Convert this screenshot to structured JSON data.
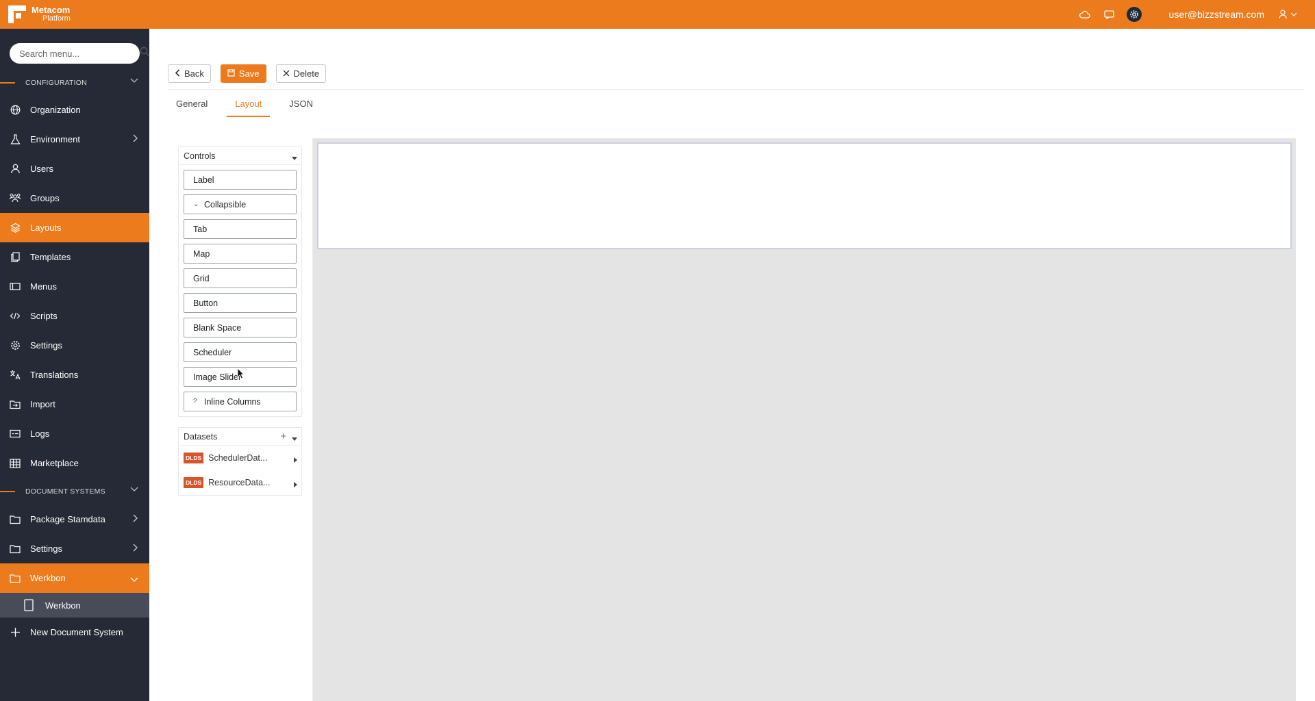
{
  "brand": {
    "name": "Metacom",
    "sub": "Platform",
    "color": "#ec7b1e"
  },
  "topbar": {
    "icons": [
      "cloud-icon",
      "chat-icon",
      "gear-icon",
      "user-icon"
    ],
    "user_email": "user@bizzstream.com"
  },
  "sidebar": {
    "search_placeholder": "Search menu...",
    "section_config": "CONFIGURATION",
    "config_items": [
      {
        "label": "Organization",
        "icon": "globe-icon"
      },
      {
        "label": "Environment",
        "icon": "flask-icon"
      },
      {
        "label": "Users",
        "icon": "user-icon"
      },
      {
        "label": "Groups",
        "icon": "group-icon"
      },
      {
        "label": "Layouts",
        "icon": "layers-icon"
      },
      {
        "label": "Templates",
        "icon": "copy-icon"
      },
      {
        "label": "Menus",
        "icon": "menu-icon"
      },
      {
        "label": "Scripts",
        "icon": "code-icon"
      },
      {
        "label": "Settings",
        "icon": "gear-icon"
      },
      {
        "label": "Translations",
        "icon": "translate-icon"
      },
      {
        "label": "Import",
        "icon": "import-icon"
      },
      {
        "label": "Logs",
        "icon": "logs-icon"
      },
      {
        "label": "Marketplace",
        "icon": "grid-icon"
      }
    ],
    "section_docs": "DOCUMENT SYSTEMS",
    "doc_items": [
      {
        "label": "Package Stamdata"
      },
      {
        "label": "Settings"
      },
      {
        "label": "Werkbon"
      }
    ],
    "sub_item": "Werkbon",
    "new_item": "New Document System"
  },
  "toolbar": {
    "back": "Back",
    "save": "Save",
    "delete": "Delete"
  },
  "tabs": [
    "General",
    "Layout",
    "JSON"
  ],
  "controls_panel": {
    "title": "Controls",
    "items": [
      {
        "label": "Label",
        "prefix": ""
      },
      {
        "label": "Collapsible",
        "prefix": "⌄"
      },
      {
        "label": "Tab",
        "prefix": ""
      },
      {
        "label": "Map",
        "prefix": ""
      },
      {
        "label": "Grid",
        "prefix": ""
      },
      {
        "label": "Button",
        "prefix": ""
      },
      {
        "label": "Blank Space",
        "prefix": ""
      },
      {
        "label": "Scheduler",
        "prefix": ""
      },
      {
        "label": "Image Slider",
        "prefix": ""
      },
      {
        "label": "Inline Columns",
        "prefix": "?"
      }
    ]
  },
  "datasets_panel": {
    "title": "Datasets",
    "badge": "DLDS",
    "items": [
      "SchedulerDat...",
      "ResourceData..."
    ]
  }
}
